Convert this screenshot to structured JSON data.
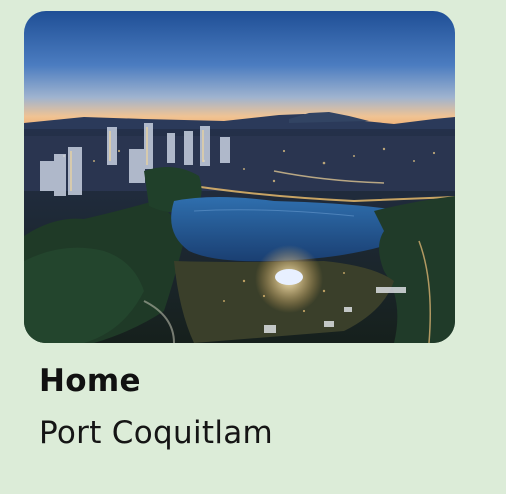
{
  "card": {
    "image": {
      "alt_name": "aerial-city-lake-dusk-photo"
    },
    "title": "Home",
    "subtitle": "Port Coquitlam"
  },
  "colors": {
    "background": "#dcecd8",
    "title_text": "#111111",
    "subtitle_text": "#151515"
  }
}
